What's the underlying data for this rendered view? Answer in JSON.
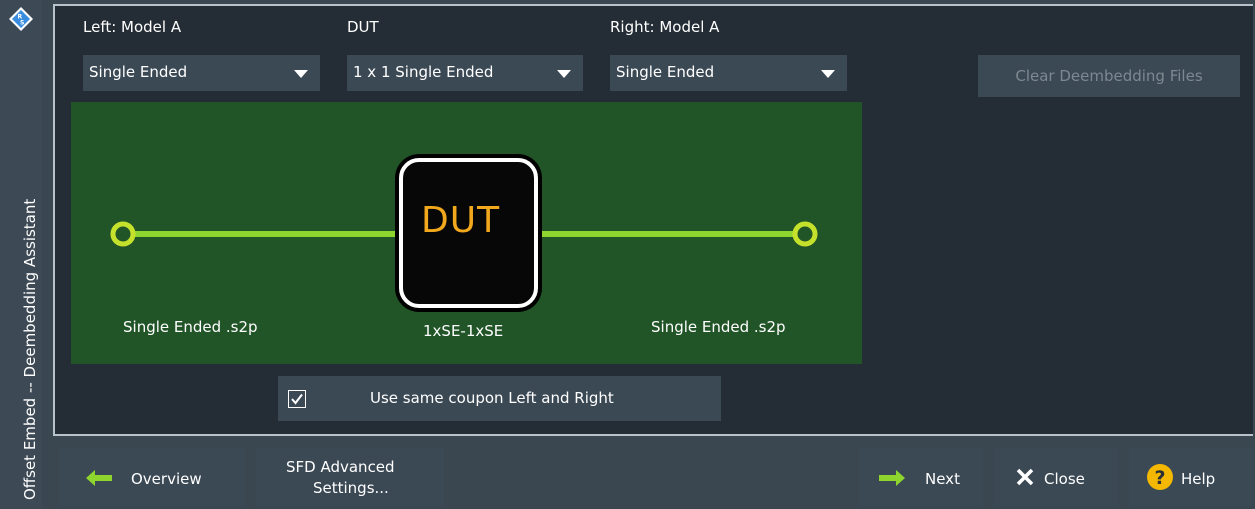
{
  "sidebar": {
    "title": "Offset Embed -- Deembedding Assistant"
  },
  "models": {
    "left_label": "Left: Model A",
    "left_value": "Single Ended",
    "dut_label": "DUT",
    "dut_value": "1 x 1 Single Ended",
    "right_label": "Right: Model A",
    "right_value": "Single Ended"
  },
  "clear_button": "Clear Deembedding Files",
  "diagram": {
    "dut_text": "DUT",
    "left_file": "Single Ended .s2p",
    "dut_file": "1xSE-1xSE",
    "right_file": "Single Ended .s2p"
  },
  "same_coupon": {
    "label": "Use same coupon Left and Right",
    "checked": true
  },
  "buttons": {
    "overview": "Overview",
    "sfd_line1": "SFD Advanced",
    "sfd_line2": "Settings...",
    "next": "Next",
    "close": "Close",
    "help": "Help"
  },
  "colors": {
    "accent_green": "#8ed62e",
    "port_yellow": "#c6e12c",
    "dut_text": "#f2a81c",
    "help_yellow": "#f5b800"
  }
}
